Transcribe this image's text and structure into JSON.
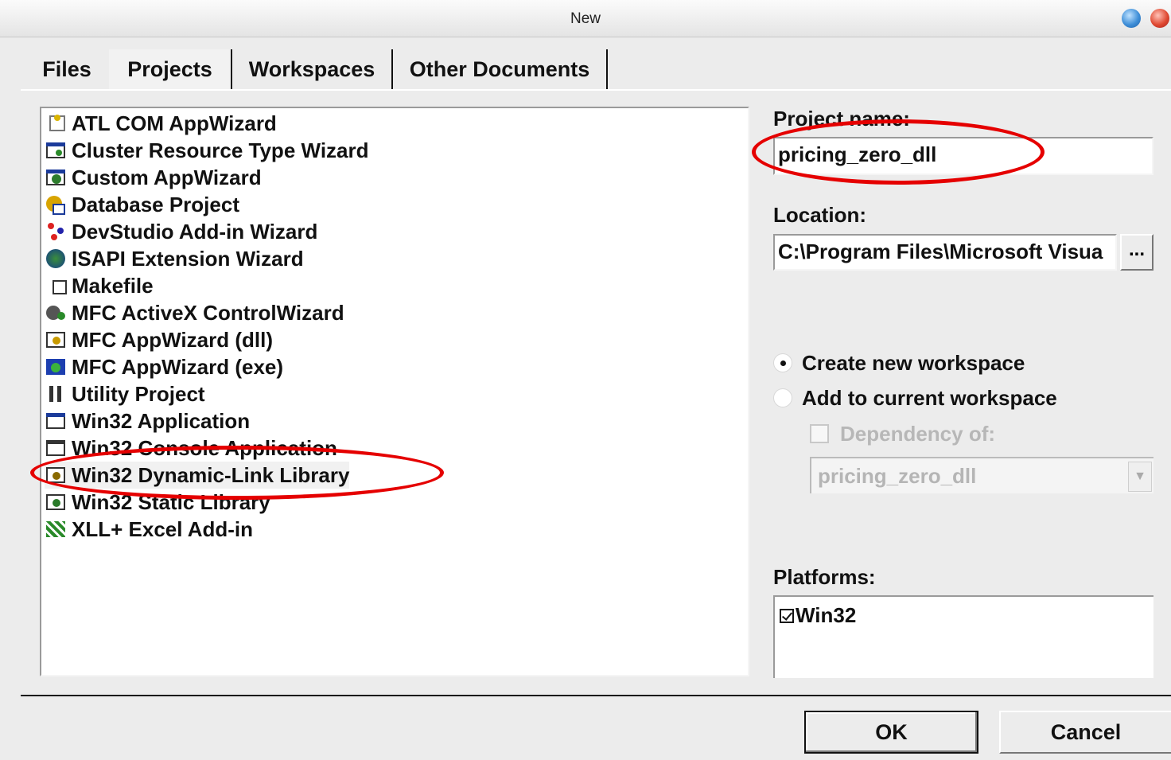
{
  "window": {
    "title": "New"
  },
  "tabs": [
    {
      "label": "Files"
    },
    {
      "label": "Projects"
    },
    {
      "label": "Workspaces"
    },
    {
      "label": "Other Documents"
    }
  ],
  "project_types": [
    {
      "label": "ATL COM AppWizard",
      "icon": "atl-com-icon"
    },
    {
      "label": "Cluster Resource Type Wizard",
      "icon": "cluster-wizard-icon"
    },
    {
      "label": "Custom AppWizard",
      "icon": "custom-appwizard-icon"
    },
    {
      "label": "Database Project",
      "icon": "database-icon"
    },
    {
      "label": "DevStudio Add-in Wizard",
      "icon": "addin-wizard-icon"
    },
    {
      "label": "ISAPI Extension Wizard",
      "icon": "globe-icon"
    },
    {
      "label": "Makefile",
      "icon": "makefile-icon"
    },
    {
      "label": "MFC ActiveX ControlWizard",
      "icon": "activex-icon"
    },
    {
      "label": "MFC AppWizard (dll)",
      "icon": "mfc-dll-icon"
    },
    {
      "label": "MFC AppWizard (exe)",
      "icon": "mfc-exe-icon"
    },
    {
      "label": "Utility Project",
      "icon": "utility-icon"
    },
    {
      "label": "Win32 Application",
      "icon": "win32-app-icon"
    },
    {
      "label": "Win32 Console Application",
      "icon": "console-icon"
    },
    {
      "label": "Win32 Dynamic-Link Library",
      "icon": "dll-icon",
      "selected": true
    },
    {
      "label": "Win32 Static Library",
      "icon": "static-lib-icon"
    },
    {
      "label": "XLL+ Excel Add-in",
      "icon": "xll-icon"
    }
  ],
  "project_name": {
    "label": "Project name:",
    "value": "pricing_zero_dll"
  },
  "location": {
    "label": "Location:",
    "value": "C:\\Program Files\\Microsoft Visua",
    "browse_label": "..."
  },
  "workspace_options": {
    "create_new": "Create new workspace",
    "add_current": "Add to current workspace",
    "dependency": "Dependency of:",
    "dependency_value": "pricing_zero_dll"
  },
  "platforms": {
    "label": "Platforms:",
    "items": [
      "Win32"
    ]
  },
  "buttons": {
    "ok": "OK",
    "cancel": "Cancel"
  },
  "annotation_color": "#e50000"
}
